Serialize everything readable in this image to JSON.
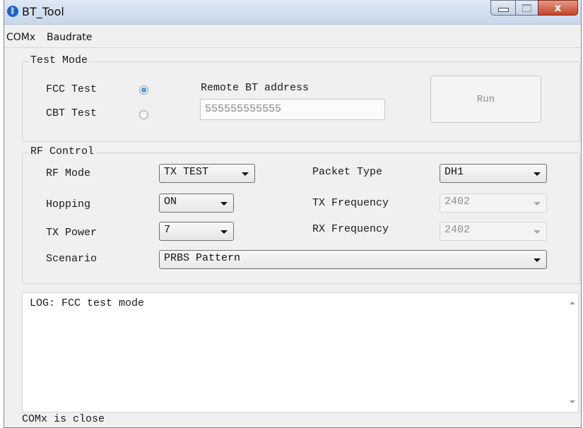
{
  "window": {
    "title": "BT_Tool",
    "app_icon": "bluetooth-icon",
    "buttons": {
      "minimize": "minimize-icon",
      "maximize": "maximize-icon",
      "close": "x"
    }
  },
  "menubar": {
    "items": [
      "COMx",
      "Baudrate"
    ]
  },
  "test_mode": {
    "legend": "Test Mode",
    "fcc_label": "FCC Test",
    "cbt_label": "CBT Test",
    "selected": "FCC Test",
    "remote_label": "Remote BT address",
    "remote_value": "555555555555",
    "run_label": "Run"
  },
  "rf_control": {
    "legend": "RF Control",
    "rf_mode_label": "RF Mode",
    "rf_mode_value": "TX TEST",
    "hopping_label": "Hopping",
    "hopping_value": "ON",
    "tx_power_label": "TX Power",
    "tx_power_value": "7",
    "scenario_label": "Scenario",
    "scenario_value": "PRBS Pattern",
    "packet_type_label": "Packet Type",
    "packet_type_value": "DH1",
    "tx_freq_label": "TX Frequency",
    "tx_freq_value": "2402",
    "rx_freq_label": "RX Frequency",
    "rx_freq_value": "2402"
  },
  "log": {
    "text": "LOG: FCC test mode"
  },
  "status": {
    "text": "COMx is close"
  },
  "colors": {
    "titlebar": "#c8d7ea",
    "close_button": "#c4432a",
    "radio_selected": "#1d65b9"
  }
}
